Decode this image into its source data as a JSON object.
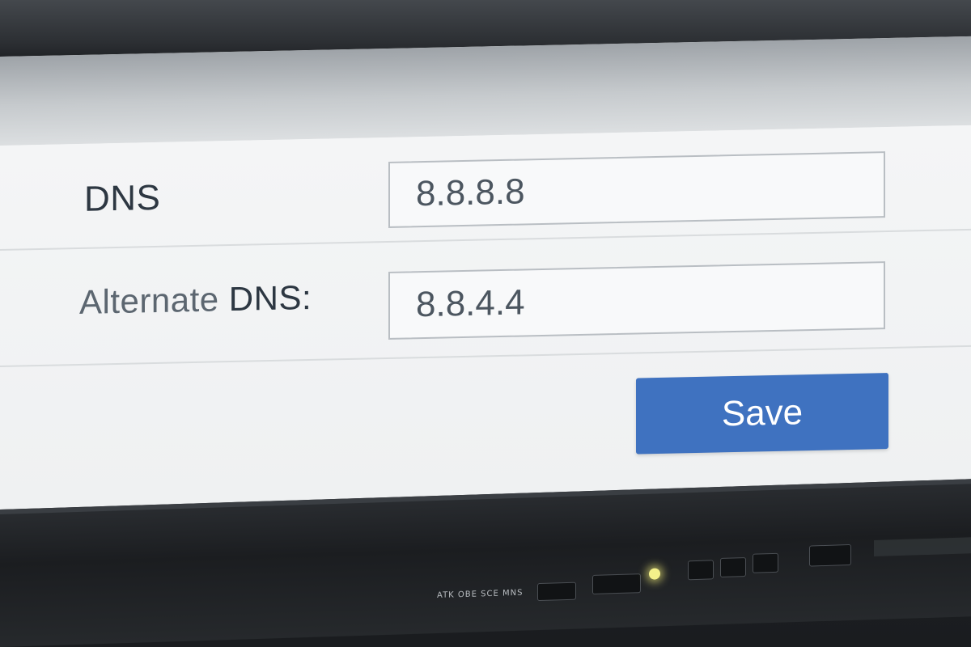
{
  "form": {
    "dns_label": "DNS",
    "alt_label_prefix": "Alternate",
    "alt_label_strong": "DNS:",
    "dns_value": "8.8.8.8",
    "alt_dns_value": "8.8.4.4",
    "save_label": "Save"
  },
  "monitor": {
    "controls_label": "ATK OBE SCE MNS"
  },
  "colors": {
    "accent": "#3f72c0",
    "label_text": "#2d3742",
    "field_border": "#b9bec3",
    "power_led": "#f4f08a"
  }
}
